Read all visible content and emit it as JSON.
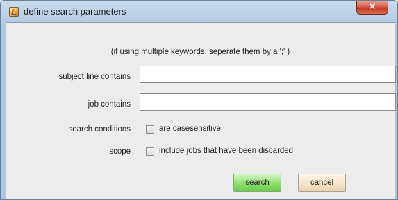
{
  "window": {
    "title": "define search parameters",
    "close_label": "✕"
  },
  "form": {
    "hint": "(if using multiple keywords, seperate them by a  ';' )",
    "subject_label": "subject line contains",
    "subject_value": "",
    "subject_placeholder": "",
    "job_label": "job contains",
    "job_value": "",
    "job_placeholder": "",
    "conditions_label": "search conditions",
    "casesensitive_label": "are casesensitive",
    "casesensitive_checked": false,
    "scope_label": "scope",
    "discarded_label": "include jobs that have been discarded",
    "discarded_checked": false
  },
  "buttons": {
    "search_label": "search",
    "cancel_label": "cancel"
  },
  "colors": {
    "search_button": "#8fde6f",
    "cancel_button": "#f5e3c7",
    "close_button": "#c2391f"
  }
}
